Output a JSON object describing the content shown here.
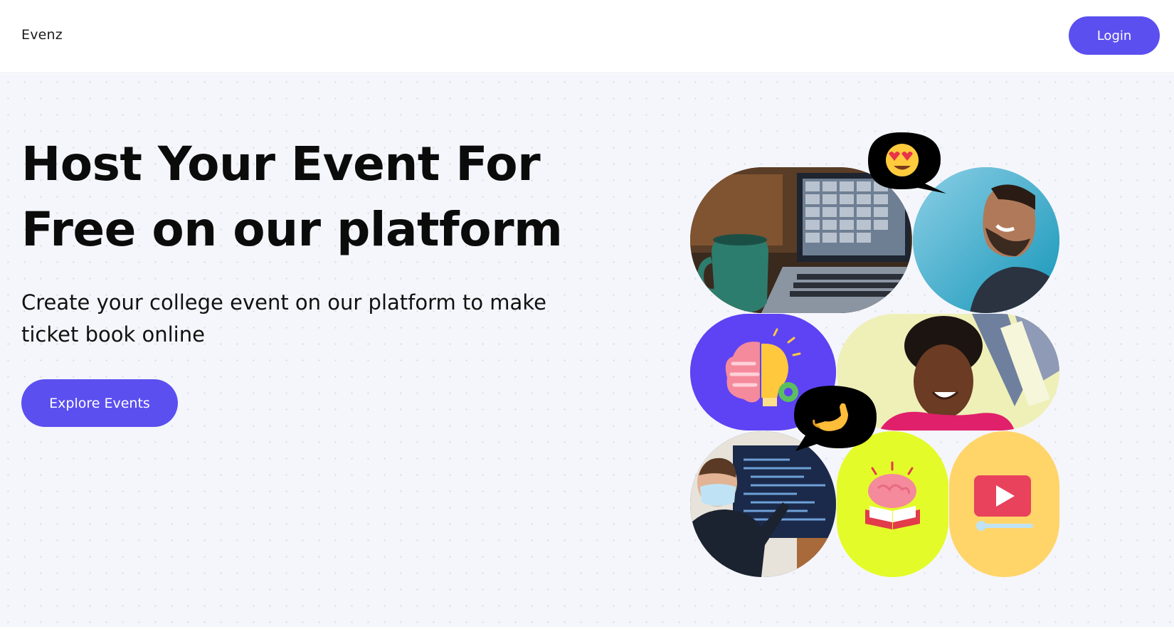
{
  "navbar": {
    "brand": "Evenz",
    "login_label": "Login"
  },
  "hero": {
    "headline_line1": "Host Your Event For",
    "headline_line2": "Free on our platform",
    "subtext_line1": "Create your college event on our platform to make",
    "subtext_line2": "ticket book online",
    "cta_label": "Explore Events"
  },
  "collage": {
    "tiles": [
      {
        "name": "video-call-laptop-photo",
        "icon": "laptop-video-call"
      },
      {
        "name": "smiling-man-photo",
        "icon": "person-photo"
      },
      {
        "name": "brain-lightbulb-illustration",
        "icon": "brain-bulb-gear"
      },
      {
        "name": "laughing-woman-photo",
        "icon": "person-photo"
      },
      {
        "name": "presenter-code-screen-photo",
        "icon": "person-presenting"
      },
      {
        "name": "brain-book-illustration",
        "icon": "brain-book"
      },
      {
        "name": "video-player-illustration",
        "icon": "video-play"
      }
    ],
    "bubbles": [
      {
        "name": "heart-eyes-emoji-bubble",
        "emoji": "heart-eyes"
      },
      {
        "name": "pinched-fingers-emoji-bubble",
        "emoji": "pinched-fingers"
      }
    ]
  },
  "colors": {
    "accent": "#5b4ff0",
    "hero_background": "#f5f6fb",
    "tile_purple": "#5d43f4",
    "tile_lime": "#e4fb2a",
    "tile_yellow": "#ffd56a"
  }
}
